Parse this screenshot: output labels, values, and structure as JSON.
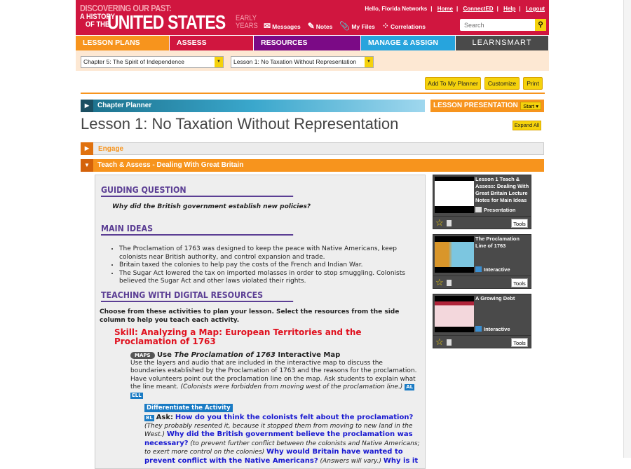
{
  "header": {
    "logo_line1": "DISCOVERING OUR PAST:",
    "logo_line2a": "A HISTORY",
    "logo_line2b": "OF THE",
    "logo_main": "UNITED STATES",
    "logo_early": "EARLY",
    "logo_years": "YEARS",
    "greeting": "Hello, Florida Networks",
    "links": [
      "Home",
      "ConnectED",
      "Help",
      "Logout"
    ],
    "tools": [
      {
        "icon": "envelope-icon",
        "label": "Messages"
      },
      {
        "icon": "notes-icon",
        "label": "Notes"
      },
      {
        "icon": "paperclip-icon",
        "label": "My Files"
      },
      {
        "icon": "correlations-icon",
        "label": "Correlations"
      }
    ],
    "search_placeholder": "Search"
  },
  "nav": [
    {
      "label": "LESSON PLANS",
      "color": "#f7941d"
    },
    {
      "label": "ASSESS",
      "color": "#d0163f"
    },
    {
      "label": "RESOURCES",
      "color": "#7b0a86"
    },
    {
      "label": "MANAGE & ASSIGN",
      "color": "#27a4dd"
    },
    {
      "label": "LEARNSMART",
      "color": "#4a4a4a"
    }
  ],
  "selects": {
    "chapter": "Chapter 5: The Spirit of Independence",
    "lesson": "Lesson 1: No Taxation Without Representation"
  },
  "buttons": {
    "planner": "Add To My Planner",
    "customize": "Customize",
    "print": "Print",
    "expand": "Expand All",
    "start": "Start"
  },
  "chapter_planner": "Chapter Planner",
  "lesson_presentation": "LESSON PRESENTATION",
  "title": "Lesson 1: No Taxation Without Representation",
  "sections": {
    "engage": "Engage",
    "teach": "Teach & Assess - Dealing With Great Britain"
  },
  "content": {
    "gq_head": "GUIDING QUESTION",
    "gq": "Why did the British government establish new policies?",
    "mi_head": "MAIN IDEAS",
    "main_ideas": [
      "The Proclamation of 1763 was designed to keep the peace with Native Americans, keep colonists near British authority, and control expansion and trade.",
      "Britain taxed the colonies to help pay the costs of the French and Indian War.",
      "The Sugar Act lowered the tax on imported molasses in order to stop smuggling. Colonists believed the Sugar Act and other laws violated their rights."
    ],
    "tdr_head": "TEACHING WITH DIGITAL RESOURCES",
    "choose": "Choose from these activities to plan your lesson. Select the resources from the side column to help you teach each activity.",
    "skill": "Skill: Analyzing a Map: European Territories and the Proclamation of 1763",
    "maps_badge": "MAPS",
    "use_pre": "Use ",
    "use_ital": "The Proclamation of 1763",
    "use_post": " Interactive Map",
    "use_body": "Use the layers and audio that are included in the interactive map to discuss the boundaries established by the Proclamation of 1763 and the reasons for the proclamation. Have volunteers point out the proclamation line on the map. Ask students to explain what the line meant. ",
    "use_ans": "(Colonists were forbidden from moving west of the proclamation line.)",
    "badge_al": "AL",
    "badge_ell": "ELL",
    "diff": "Differentiate the Activity",
    "badge_bl": "BL",
    "ask": "Ask:",
    "q1": "How do you think the colonists felt about the proclamation?",
    "a1": "(They probably resented it, because it stopped them from moving to new land in the West.)",
    "q2": "Why did the British government believe the proclamation was necessary?",
    "a2": "(to prevent further conflict between the colonists and Native Americans; to exert more control on the colonies)",
    "q3": "Why would Britain have wanted to prevent conflict with the Native Americans?",
    "a3": "(Answers will vary.)",
    "q4": "Why is it"
  },
  "resources": [
    {
      "title": "Lesson 1 Teach & Assess: Dealing With Great Britain Lecture Notes for Main Ideas",
      "type": "Presentation",
      "tools": "Tools"
    },
    {
      "title": "The Proclamation Line of 1763",
      "type": "Interactive",
      "tools": "Tools"
    },
    {
      "title": "A Growing Debt",
      "type": "Interactive",
      "tools": "Tools"
    }
  ]
}
